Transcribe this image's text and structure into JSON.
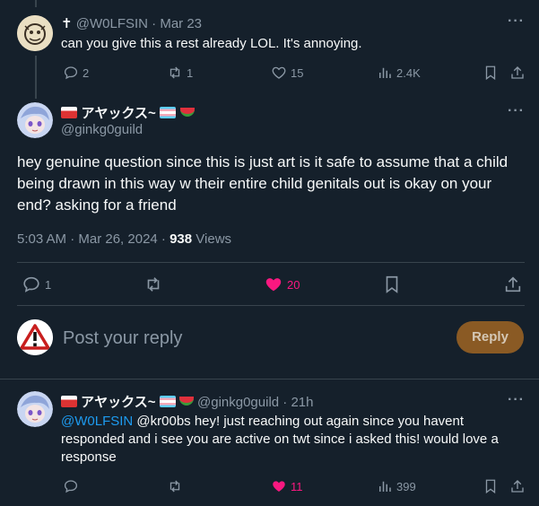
{
  "tweet1": {
    "cross": "✝",
    "handle": "@W0LFSIN",
    "sep": "·",
    "date": "Mar 23",
    "text": "can you give this a rest already LOL. It's annoying.",
    "replies": "2",
    "retweets": "1",
    "likes": "15",
    "views": "2.4K"
  },
  "main_tweet": {
    "display_name": "アヤックス~",
    "handle": "@ginkg0guild",
    "text": "hey genuine question since this is just art is it safe to assume that a child being drawn in this way w their entire child genitals out is okay on your end? asking for a friend",
    "timestamp": "5:03 AM · Mar 26, 2024 · ",
    "views_count": "938",
    "views_label": " Views",
    "replies": "1",
    "likes": "20"
  },
  "reply_box": {
    "placeholder": "Post your reply",
    "button": "Reply"
  },
  "tweet3": {
    "display_name": "アヤックス~",
    "handle": "@ginkg0guild",
    "sep": "·",
    "age": "21h",
    "mention1": "@W0LFSIN",
    "text": " @kr00bs hey! just reaching out again since you havent responded and i see you are active on twt since i asked this! would love a response",
    "likes": "11",
    "views": "399"
  },
  "more_label": "···",
  "colors": {
    "background": "#15202b",
    "text": "#f7f9f9",
    "muted": "#8b98a5",
    "like_active": "#f91880",
    "link": "#1d9bf0",
    "reply_button": "#8a5a24",
    "divider": "#38444d"
  }
}
